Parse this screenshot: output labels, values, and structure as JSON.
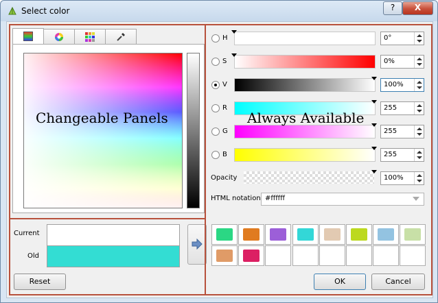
{
  "window": {
    "title": "Select color",
    "help": "?",
    "close": "X"
  },
  "tabs": [
    {
      "name": "color-wheel-tab",
      "icon": "ramp-icon"
    },
    {
      "name": "color-wheel-tab",
      "icon": "wheel-icon"
    },
    {
      "name": "swatches-tab",
      "icon": "grid-icon"
    },
    {
      "name": "picker-tab",
      "icon": "eyedropper-icon"
    }
  ],
  "annotations": {
    "left": "Changeable Panels",
    "right": "Always Available"
  },
  "channels": [
    {
      "key": "H",
      "value": "0°",
      "selected": false,
      "gradient": "linear-gradient(to right,#fff,#fff)"
    },
    {
      "key": "S",
      "value": "0%",
      "selected": false,
      "gradient": "linear-gradient(to right,#fff,#ff0000)"
    },
    {
      "key": "V",
      "value": "100%",
      "selected": true,
      "gradient": "linear-gradient(to right,#000,#fff)"
    },
    {
      "key": "R",
      "value": "255",
      "selected": false,
      "gradient": "linear-gradient(to right,#00ffff,#fff)"
    },
    {
      "key": "G",
      "value": "255",
      "selected": false,
      "gradient": "linear-gradient(to right,#ff00ff,#fff)"
    },
    {
      "key": "B",
      "value": "255",
      "selected": false,
      "gradient": "linear-gradient(to right,#ffff00,#fff)"
    }
  ],
  "opacity": {
    "label": "Opacity",
    "value": "100%"
  },
  "html_notation": {
    "label": "HTML notation",
    "value": "#ffffff"
  },
  "preview": {
    "current_label": "Current",
    "old_label": "Old",
    "current_color": "#ffffff",
    "old_color": "#33ddd3"
  },
  "swatches": [
    "#2bd784",
    "#e07b20",
    "#9c5fd8",
    "#33d7d7",
    "#e2cab2",
    "#bcd91f",
    "#93c3e1",
    "#c8e0a7",
    "#e09b67",
    "#dc2063",
    "",
    "",
    "",
    "",
    "",
    ""
  ],
  "buttons": {
    "reset": "Reset",
    "ok": "OK",
    "cancel": "Cancel"
  }
}
